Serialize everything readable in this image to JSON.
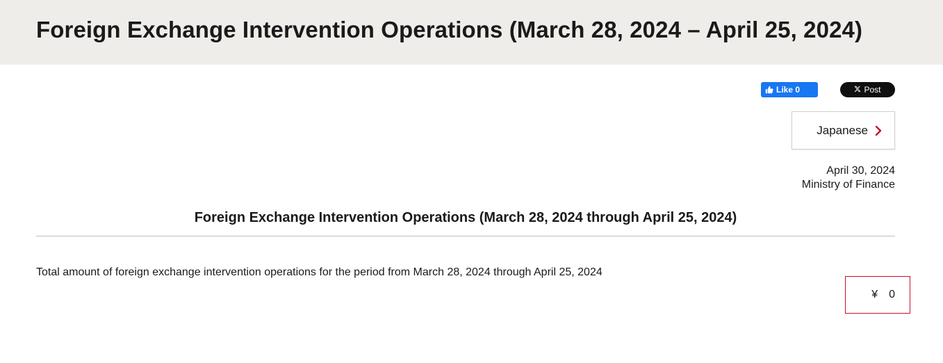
{
  "header": {
    "title": "Foreign Exchange Intervention Operations (March 28, 2024 – April 25, 2024)"
  },
  "social": {
    "like_label": "Like 0",
    "post_label": "Post"
  },
  "language_button": {
    "label": "Japanese",
    "icon": "chevron-right-icon",
    "icon_color": "#c8102e"
  },
  "meta": {
    "date": "April 30, 2024",
    "publisher": "Ministry of Finance"
  },
  "document": {
    "title": "Foreign Exchange Intervention Operations (March 28, 2024 through April 25, 2024)",
    "body": "Total amount of foreign exchange intervention operations for the period from March 28, 2024 through April 25, 2024",
    "currency_symbol": "¥",
    "amount": "0"
  },
  "colors": {
    "header_bg": "#eeedea",
    "facebook_blue": "#1877f2",
    "x_black": "#0f0f0f",
    "highlight_red": "#c8102e"
  }
}
